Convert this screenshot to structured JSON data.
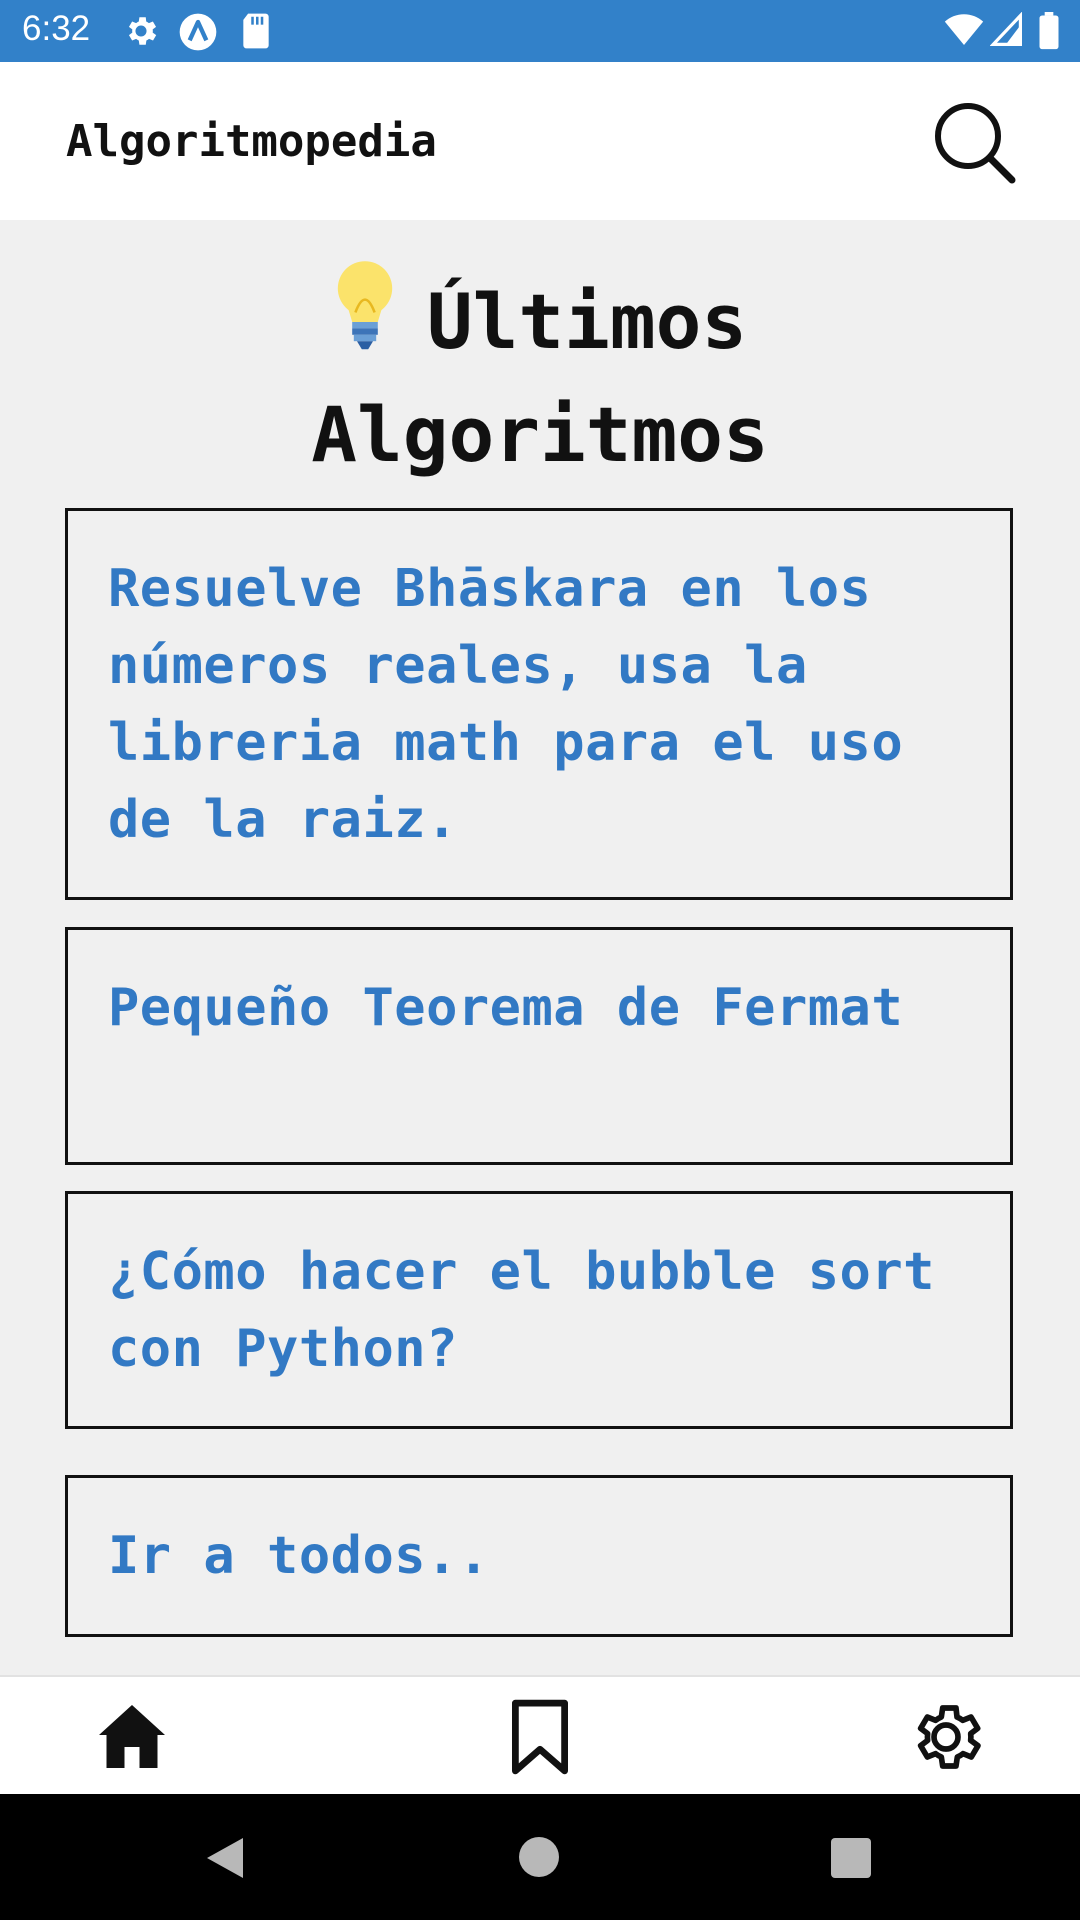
{
  "status_bar": {
    "time": "6:32",
    "icons": [
      "gear-icon",
      "app-icon",
      "sd-card-icon",
      "wifi-icon",
      "signal-icon",
      "battery-icon"
    ]
  },
  "app_bar": {
    "title": "Algoritmopedia",
    "search_icon": "search-icon"
  },
  "section": {
    "title": "Últimos Algoritmos",
    "icon": "lightbulb-icon"
  },
  "cards": [
    {
      "text": "Resuelve Bhāskara en los números reales, usa la libreria math para el uso de la raiz."
    },
    {
      "text": "Pequeño Teorema de Fermat"
    },
    {
      "text": "¿Cómo hacer el bubble sort con Python?"
    },
    {
      "text": "Ir a todos.."
    }
  ],
  "bottom_nav": {
    "items": [
      "home-icon",
      "bookmark-icon",
      "settings-icon"
    ]
  },
  "system_nav": {
    "items": [
      "back-icon",
      "home-circle-icon",
      "recents-icon"
    ]
  },
  "colors": {
    "status_bar": "#3281c9",
    "card_text": "#3279c4",
    "background": "#f0f0f0"
  }
}
